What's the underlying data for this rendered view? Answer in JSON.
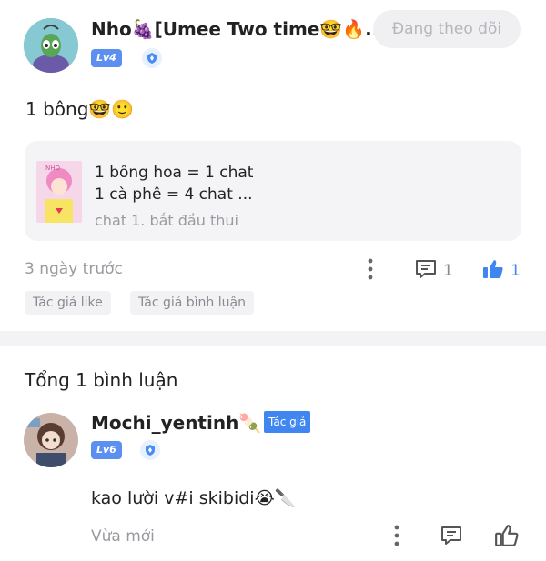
{
  "post": {
    "author_name": "Nho🍇[Umee Two time🤓🔥...",
    "level": "Lv4",
    "follow_label": "Đang theo dõi",
    "body": "1 bông🤓🙂",
    "card": {
      "line1": "1 bông hoa = 1 chat",
      "line2": "1 cà phê = 4 chat ...",
      "line3": "chat 1. bắt đầu thui"
    },
    "time": "3 ngày trước",
    "comment_count": "1",
    "like_count": "1",
    "tags": [
      "Tác giả like",
      "Tác giả bình luận"
    ]
  },
  "comments_section": {
    "total_label": "Tổng 1 bình luận",
    "comment": {
      "author_name": "Mochi_yentinh🍡",
      "author_badge": "Tác giả",
      "level": "Lv6",
      "text": "kao lười v#i skibidi😭🔪",
      "time": "Vừa mới"
    }
  },
  "colors": {
    "accent": "#3f86f0",
    "level_badge": "#5b8ff0",
    "muted_text": "#9a9aa0"
  },
  "icons": [
    "more-vertical-icon",
    "comment-icon",
    "thumbs-up-filled-icon",
    "thumbs-up-outline-icon",
    "shield-icon"
  ]
}
